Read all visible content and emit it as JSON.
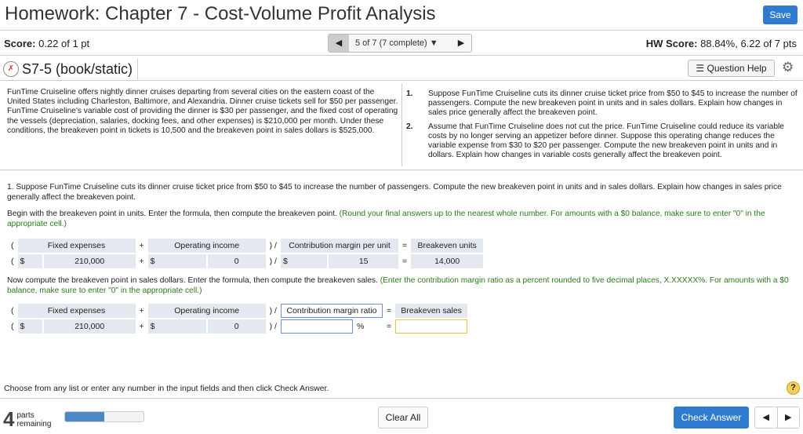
{
  "header": {
    "title": "Homework: Chapter 7 - Cost-Volume Profit Analysis",
    "save": "Save",
    "score_label": "Score:",
    "score_value": "0.22 of 1 pt",
    "nav_text": "5 of 7 (7 complete)",
    "hw_label": "HW Score:",
    "hw_value": "88.84%, 6.22 of 7 pts"
  },
  "question": {
    "id": "S7-5 (book/static)",
    "help": "Question Help",
    "intro": "FunTime Cruiseline offers nightly dinner cruises departing from several cities on the eastern coast of the United States including Charleston, Baltimore, and Alexandria. Dinner cruise tickets sell for $50 per passenger. FunTime Cruiseline's variable cost of providing the dinner is $30 per passenger, and the fixed cost of operating the vessels (depreciation, salaries, docking fees, and other expenses) is $210,000 per month. Under these conditions, the breakeven point in tickets is 10,500 and the breakeven point in sales dollars is $525,000.",
    "items": [
      {
        "n": "1.",
        "text": "Suppose FunTime Cruiseline cuts its dinner cruise ticket price from $50 to $45 to increase the number of passengers. Compute the new breakeven point in units and in sales dollars. Explain how changes in sales price generally affect the breakeven point."
      },
      {
        "n": "2.",
        "text": "Assume that FunTime Cruiseline does not cut the price. FunTime Cruiseline could reduce its variable costs by no longer serving an appetizer before dinner. Suppose this operating change reduces the variable expense from $30 to $20 per passenger. Compute the new breakeven point in units and in dollars. Explain how changes in variable costs generally affect the breakeven point."
      }
    ]
  },
  "main": {
    "part1": "1. Suppose FunTime Cruiseline cuts its dinner cruise ticket price from $50 to $45 to increase the number of passengers. Compute the new breakeven point in units and in sales dollars. Explain how changes in sales price generally affect the breakeven point.",
    "units_instr": "Begin with the breakeven point in units. Enter the formula, then compute the breakeven point.",
    "units_hint": "(Round your final answers up to the nearest whole number. For amounts with a $0 balance, make sure to enter \"0\" in the appropriate cell.)",
    "sales_instr": "Now compute the breakeven point in sales dollars. Enter the formula, then compute the breakeven sales.",
    "sales_hint": "(Enter the contribution margin ratio as a percent rounded to five decimal places, X.XXXXX%. For amounts with a $0 balance, make sure to enter \"0\" in the appropriate cell.)"
  },
  "t1": {
    "open": "(",
    "h1": "Fixed expenses",
    "plus": "+",
    "h2": "Operating income",
    "div": ") /",
    "h3": "Contribution margin per unit",
    "eq": "=",
    "h4": "Breakeven units",
    "dollar": "$",
    "v1": "210,000",
    "v2": "0",
    "v3": "15",
    "v4": "14,000"
  },
  "t2": {
    "h1": "Fixed expenses",
    "h2": "Operating income",
    "h3": "Contribution margin ratio",
    "h4": "Breakeven sales",
    "v1": "210,000",
    "v2": "0",
    "pct": "%"
  },
  "footer": {
    "choose": "Choose from any list or enter any number in the input fields and then click Check Answer.",
    "help": "?",
    "parts_num": "4",
    "parts_l1": "parts",
    "parts_l2": "remaining",
    "progress": 0.5,
    "clear": "Clear All",
    "check": "Check Answer"
  }
}
